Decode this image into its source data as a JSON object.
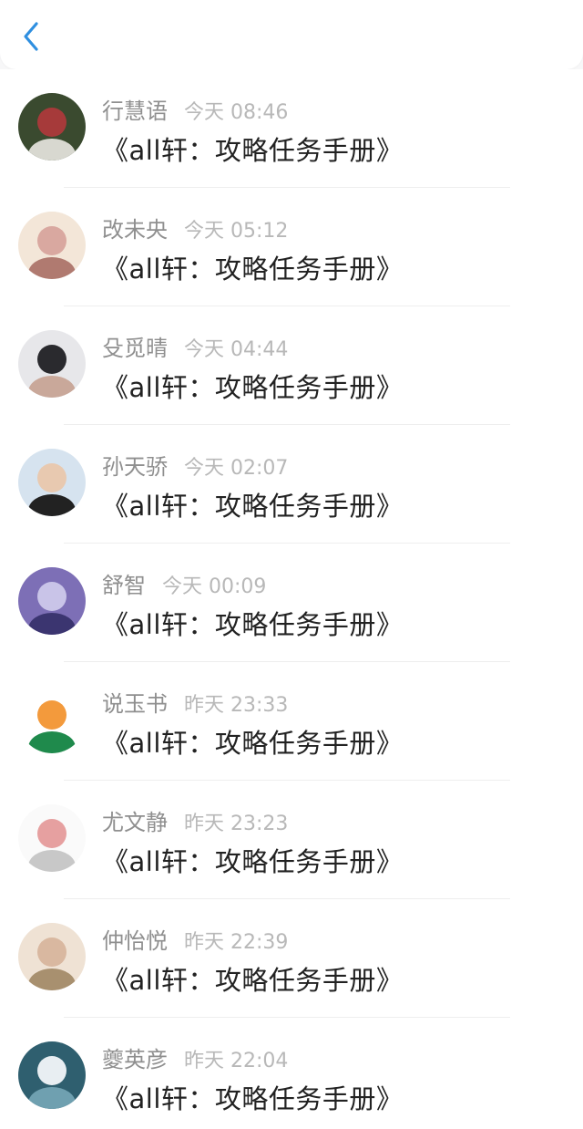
{
  "header": {
    "back_icon": "chevron-left-icon",
    "accent_color": "#2f8fe0"
  },
  "messages": [
    {
      "name": "行慧语",
      "time": "今天 08:46",
      "text": "《all轩：攻略任务手册》",
      "avatar_colors": [
        "#3a4a2f",
        "#a63a3a",
        "#d8d8d0"
      ]
    },
    {
      "name": "改未央",
      "time": "今天 05:12",
      "text": "《all轩：攻略任务手册》",
      "avatar_colors": [
        "#f3e6d8",
        "#d9a8a0",
        "#b07a70"
      ]
    },
    {
      "name": "殳觅晴",
      "time": "今天 04:44",
      "text": "《all轩：攻略任务手册》",
      "avatar_colors": [
        "#e7e7ea",
        "#2a2a2e",
        "#c9a89a"
      ]
    },
    {
      "name": "孙天骄",
      "time": "今天 02:07",
      "text": "《all轩：攻略任务手册》",
      "avatar_colors": [
        "#d6e3ef",
        "#e8c9b0",
        "#222222"
      ]
    },
    {
      "name": "舒智",
      "time": "今天 00:09",
      "text": "《all轩：攻略任务手册》",
      "avatar_colors": [
        "#7d6fb6",
        "#c9c4e8",
        "#3b3570"
      ]
    },
    {
      "name": "说玉书",
      "time": "昨天 23:33",
      "text": "《all轩：攻略任务手册》",
      "avatar_colors": [
        "#ffffff",
        "#f39a3c",
        "#1f8a4c"
      ]
    },
    {
      "name": "尤文静",
      "time": "昨天 23:23",
      "text": "《all轩：攻略任务手册》",
      "avatar_colors": [
        "#fafafa",
        "#e6a0a0",
        "#c8c8c8"
      ]
    },
    {
      "name": "仲怡悦",
      "time": "昨天 22:39",
      "text": "《all轩：攻略任务手册》",
      "avatar_colors": [
        "#efe2d4",
        "#d9b8a0",
        "#a8906f"
      ]
    },
    {
      "name": "夔英彦",
      "time": "昨天 22:04",
      "text": "《all轩：攻略任务手册》",
      "avatar_colors": [
        "#2f5f6f",
        "#e8eef2",
        "#6fa0b0"
      ]
    }
  ]
}
